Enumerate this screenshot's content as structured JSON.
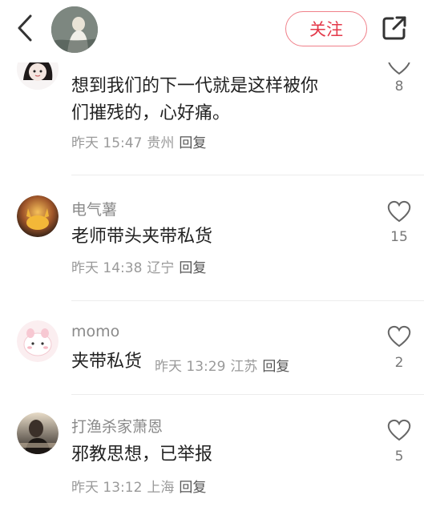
{
  "header": {
    "follow_label": "关注",
    "back_icon": "chevron-left-icon",
    "share_icon": "share-external-icon"
  },
  "comments": [
    {
      "username": "",
      "lines": [
        "想到我们的下一代就是这样被你",
        "们摧残的，心好痛。"
      ],
      "time": "昨天 15:47",
      "location": "贵州",
      "reply": "回复",
      "likes": "8"
    },
    {
      "username": "电气薯",
      "text": "老师带头夹带私货",
      "time": "昨天 14:38",
      "location": "辽宁",
      "reply": "回复",
      "likes": "15"
    },
    {
      "username": "momo",
      "text": "夹带私货",
      "time": "昨天 13:29",
      "location": "江苏",
      "reply": "回复",
      "likes": "2"
    },
    {
      "username": "打渔杀家萧恩",
      "text": "邪教思想，已举报",
      "time": "昨天 13:12",
      "location": "上海",
      "reply": "回复",
      "likes": "5"
    }
  ]
}
